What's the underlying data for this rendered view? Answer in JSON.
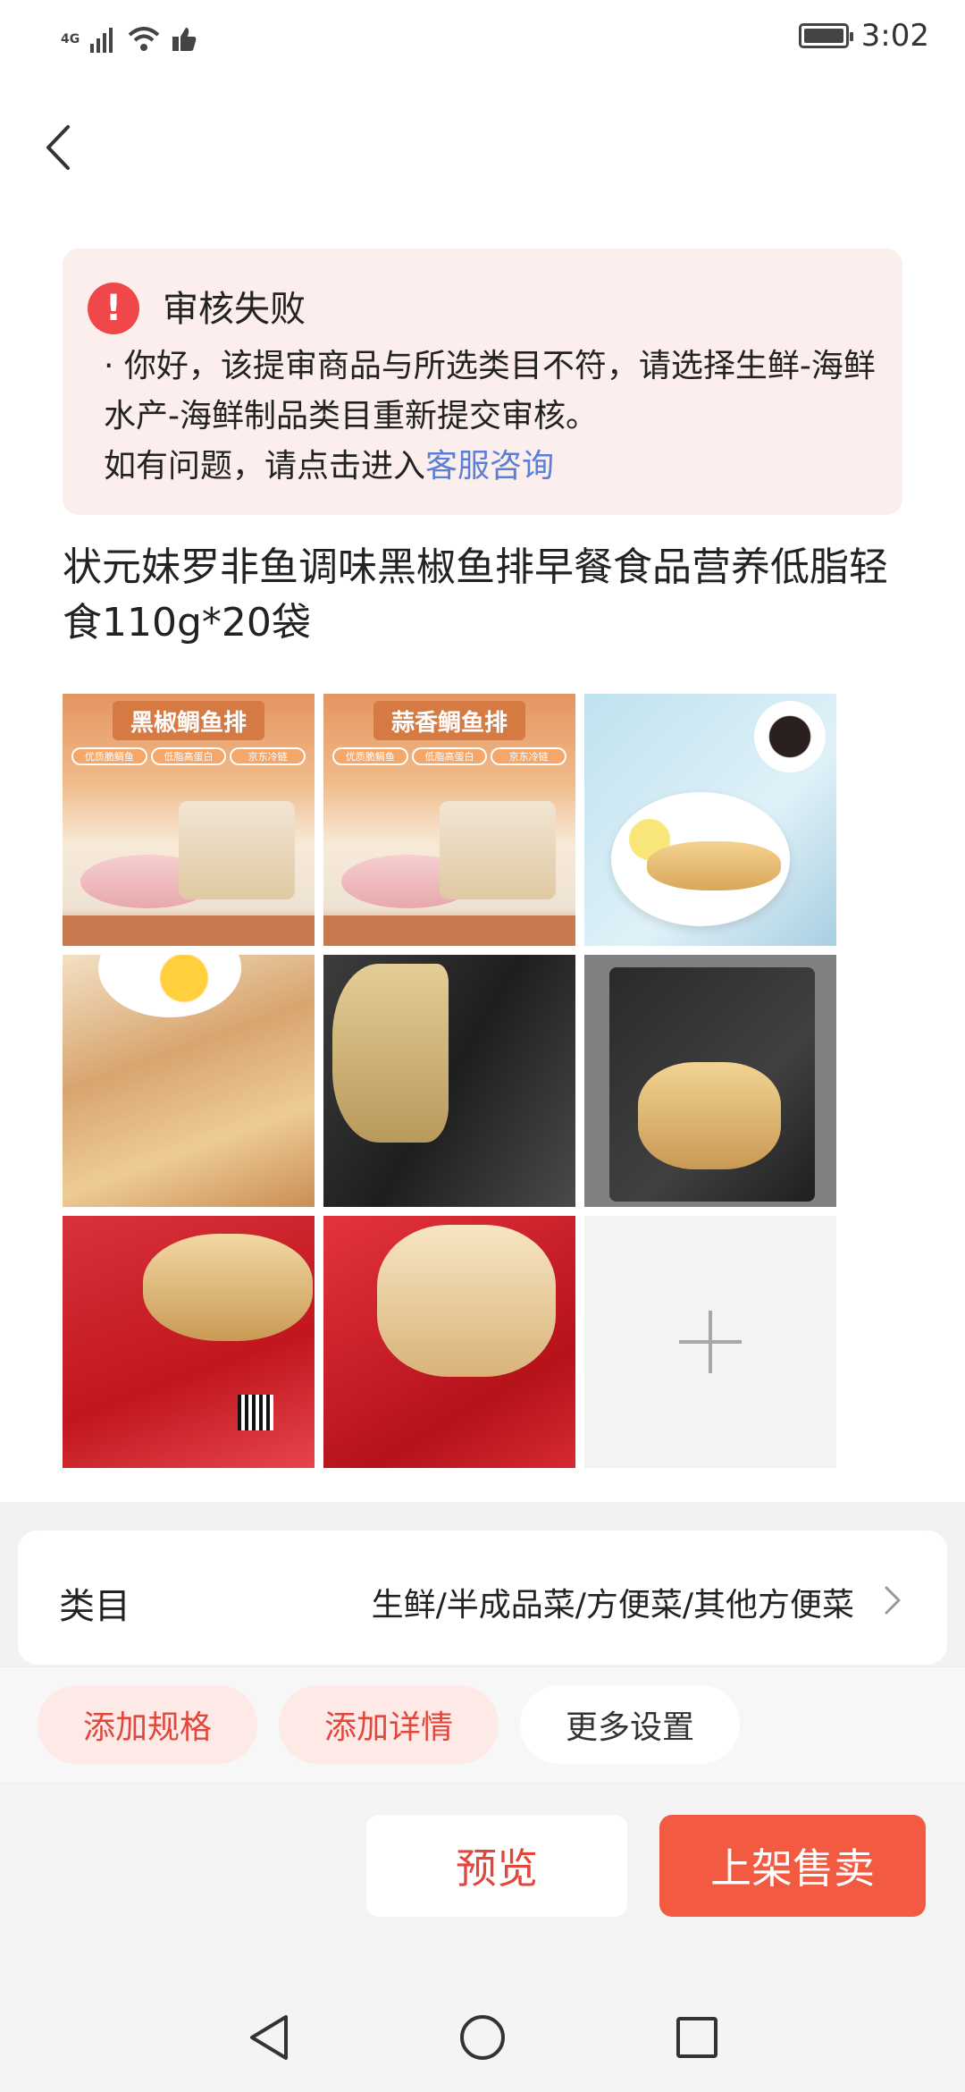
{
  "status_bar": {
    "network": "4G",
    "time": "3:02"
  },
  "error_card": {
    "title": "审核失败",
    "message": "· 你好，该提审商品与所选类目不符，请选择生鲜-海鲜水产-海鲜制品类目重新提交审核。",
    "help_prefix": "如有问题，请点击进入",
    "help_link": "客服咨询",
    "icon_color": "#f0484a",
    "link_color": "#5b7fd6"
  },
  "product": {
    "title": "状元妹罗非鱼调味黑椒鱼排早餐食品营养低脂轻食110g*20袋"
  },
  "images": {
    "tile1": {
      "banner": "黑椒鲷鱼排",
      "chips": [
        "优质脆鲷鱼",
        "低脂高蛋白",
        "京东冷链"
      ]
    },
    "tile2": {
      "banner": "蒜香鲷鱼排",
      "chips": [
        "优质脆鲷鱼",
        "低脂高蛋白",
        "京东冷链"
      ]
    },
    "add_icon": "plus-icon"
  },
  "category": {
    "label": "类目",
    "value": "生鲜/半成品菜/方便菜/其他方便菜"
  },
  "chips": {
    "add_spec": "添加规格",
    "add_detail": "添加详情",
    "more_settings": "更多设置"
  },
  "actions": {
    "preview": "预览",
    "list_for_sale": "上架售卖",
    "accent_color": "#f25a42"
  },
  "nav": {
    "back_icon": "triangle-back-icon",
    "home_icon": "circle-home-icon",
    "recent_icon": "square-recent-icon"
  }
}
